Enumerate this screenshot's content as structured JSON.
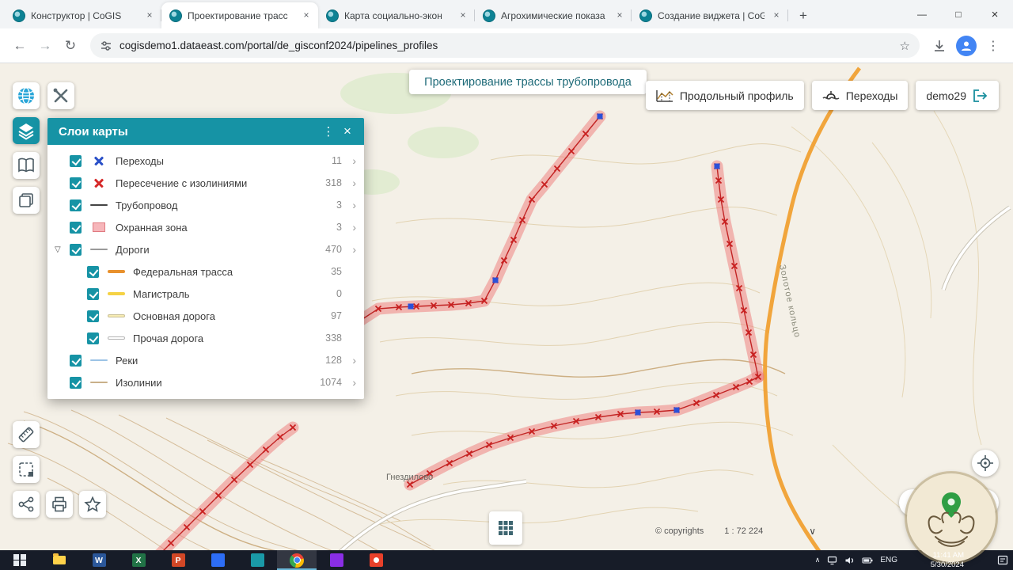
{
  "icons": {
    "close": "×",
    "kebab": "⋮",
    "chevron_right": "›",
    "chevron_down": "∨",
    "plus": "+",
    "minimize": "—",
    "maximize": "□",
    "back": "←",
    "forward": "→",
    "reload": "↻",
    "star": "☆",
    "triangle_down": "▽",
    "tray_up": "∧"
  },
  "colors": {
    "accent_teal": "#1693a5",
    "pipeline_red": "#c81e1e",
    "buffer_pink": "#ee7878",
    "road_orange": "#f0a033"
  },
  "browser": {
    "tabs": [
      {
        "title": "Конструктор | CoGIS"
      },
      {
        "title": "Проектирование трасс"
      },
      {
        "title": "Карта социально-экон"
      },
      {
        "title": "Агрохимические показа"
      },
      {
        "title": "Создание виджета | CoG"
      }
    ],
    "url": "cogisdemo1.dataeast.com/portal/de_gisconf2024/pipelines_profiles"
  },
  "app": {
    "tooltip": "Проектирование трассы трубопровода",
    "buttons": {
      "profile": "Продольный профиль",
      "crossings": "Переходы",
      "user": "demo29"
    },
    "layers_panel": {
      "title": "Слои карты",
      "layers": [
        {
          "label": "Переходы",
          "count": "11"
        },
        {
          "label": "Пересечение с изолиниями",
          "count": "318"
        },
        {
          "label": "Трубопровод",
          "count": "3"
        },
        {
          "label": "Охранная зона",
          "count": "3"
        },
        {
          "label": "Дороги",
          "count": "470"
        },
        {
          "label": "Федеральная трасса",
          "count": "35"
        },
        {
          "label": "Магистраль",
          "count": "0"
        },
        {
          "label": "Основная дорога",
          "count": "97"
        },
        {
          "label": "Прочая дорога",
          "count": "338"
        },
        {
          "label": "Реки",
          "count": "128"
        },
        {
          "label": "Изолинии",
          "count": "1074"
        }
      ]
    },
    "map": {
      "place_label": "Гнездилово",
      "road_label": "Золотое кольцо",
      "copyright": "© copyrights",
      "scale": "1 : 72 224"
    }
  },
  "taskbar": {
    "app_letters": {
      "word": "W",
      "excel": "X",
      "powerpoint": "P"
    },
    "lang": "ENG",
    "time": "11:41 AM",
    "date": "5/30/2024"
  }
}
